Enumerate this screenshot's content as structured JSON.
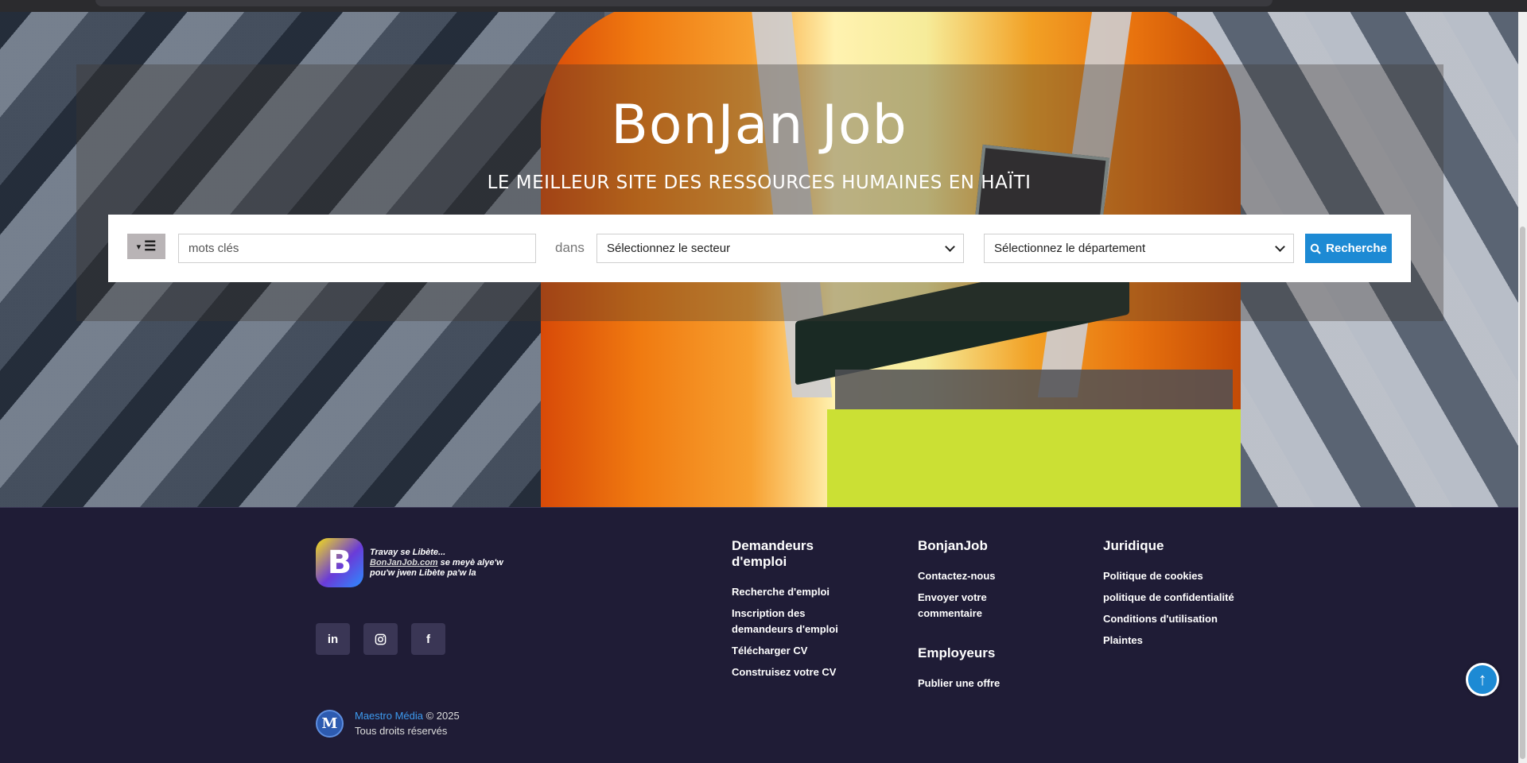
{
  "hero": {
    "title": "BonJan Job",
    "subtitle": "LE MEILLEUR SITE DES RESSOURCES HUMAINES EN HAÏTI"
  },
  "search": {
    "keyword_placeholder": "mots clés",
    "keyword_value": "",
    "in_label": "dans",
    "sector_selected": "Sélectionnez le secteur",
    "department_selected": "Sélectionnez le département",
    "button_label": "Recherche"
  },
  "footer": {
    "tagline_line1": "Travay se Libète...",
    "tagline_brand": "BonJanJob.com",
    "tagline_line2_rest": " se meyè alye'w",
    "tagline_line3": "pou'w jwen Libète pa'w la",
    "logo_letter": "B",
    "socials": [
      {
        "name": "linkedin",
        "glyph": "in"
      },
      {
        "name": "instagram",
        "glyph": "◎"
      },
      {
        "name": "facebook",
        "glyph": "f"
      }
    ],
    "copyright_brand": "Maestro Média",
    "copyright_year": " © 2025",
    "rights": "Tous droits réservés",
    "mm_glyph": "M",
    "columns": {
      "job_seekers": {
        "title": "Demandeurs d'emploi",
        "links": [
          "Recherche d'emploi",
          "Inscription des demandeurs d'emploi",
          "Télécharger CV",
          "Construisez votre CV"
        ]
      },
      "bonjanjob": {
        "title": "BonjanJob",
        "links": [
          "Contactez-nous",
          "Envoyer votre commentaire"
        ]
      },
      "employers": {
        "title": "Employeurs",
        "links": [
          "Publier une offre"
        ]
      },
      "legal": {
        "title": "Juridique",
        "links": [
          "Politique de cookies",
          "politique de confidentialité",
          "Conditions d'utilisation",
          "Plaintes"
        ]
      }
    }
  },
  "icons": {
    "menu_caret": "▾",
    "menu_bars": "☰",
    "search": "🔍",
    "to_top": "↑"
  },
  "colors": {
    "accent": "#1d8ad4",
    "footer_bg": "#1f1c36"
  }
}
